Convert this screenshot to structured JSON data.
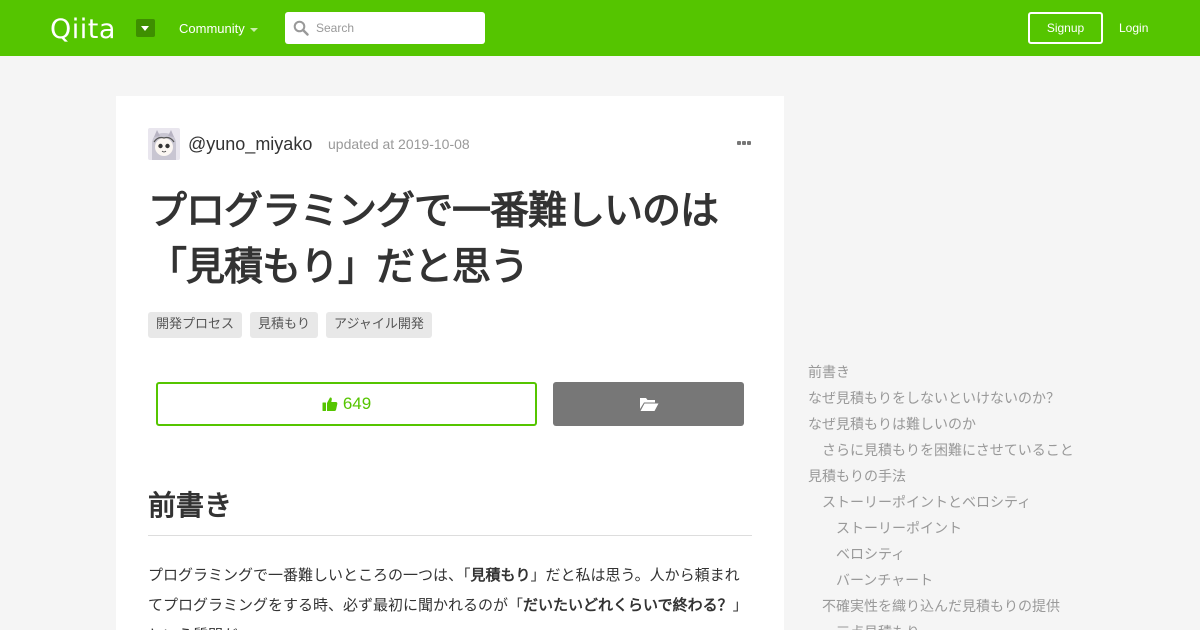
{
  "header": {
    "logo_text": "Qiita",
    "community_label": "Community",
    "search_placeholder": "Search",
    "signup_label": "Signup",
    "login_label": "Login",
    "brand_color": "#55c500"
  },
  "article": {
    "author": "@yuno_miyako",
    "updated": "updated at 2019-10-08",
    "title": "プログラミングで一番難しいのは「見積もり」だと思う",
    "tags": [
      "開発プロセス",
      "見積もり",
      "アジャイル開発"
    ],
    "like_count": "649",
    "heading": "前書き",
    "paragraph": {
      "t1": "プログラミングで一番難しいところの一つは、「",
      "b1": "見積もり",
      "t2": "」だと私は思う。人から頼まれてプログラミングをする時、必ず最初に聞かれるのが「",
      "b2": "だいたいどれくらいで終わる？",
      "t3": "」という質問だ。"
    }
  },
  "toc": [
    {
      "label": "前書き",
      "level": 1
    },
    {
      "label": "なぜ見積もりをしないといけないのか？",
      "level": 1
    },
    {
      "label": "なぜ見積もりは難しいのか",
      "level": 1
    },
    {
      "label": "さらに見積もりを困難にさせていること",
      "level": 2
    },
    {
      "label": "見積もりの手法",
      "level": 1
    },
    {
      "label": "ストーリーポイントとベロシティ",
      "level": 2
    },
    {
      "label": "ストーリーポイント",
      "level": 3
    },
    {
      "label": "ベロシティ",
      "level": 3
    },
    {
      "label": "バーンチャート",
      "level": 3
    },
    {
      "label": "不確実性を織り込んだ見積もりの提供",
      "level": 2
    },
    {
      "label": "三点見積もり",
      "level": 3
    }
  ]
}
